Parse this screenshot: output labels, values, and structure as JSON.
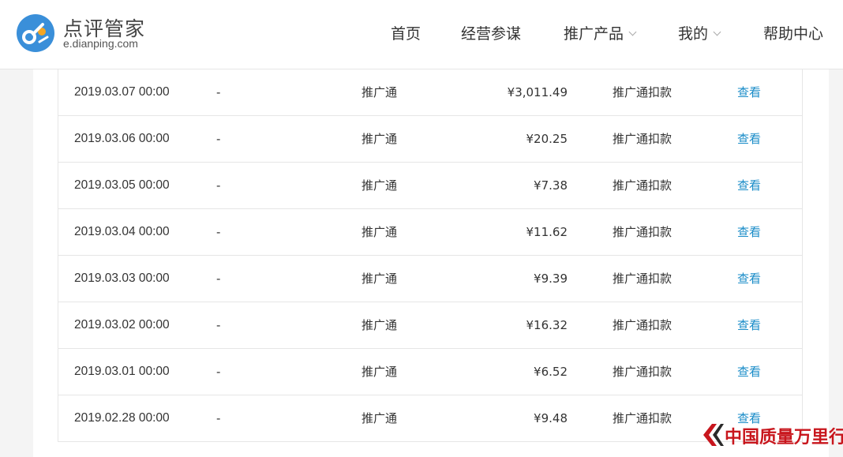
{
  "header": {
    "brand_title": "点评管家",
    "brand_url": "e.dianping.com",
    "nav": [
      {
        "label": "首页",
        "has_dropdown": false
      },
      {
        "label": "经营参谋",
        "has_dropdown": false
      },
      {
        "label": "推广产品",
        "has_dropdown": true
      },
      {
        "label": "我的",
        "has_dropdown": true
      },
      {
        "label": "帮助中心",
        "has_dropdown": false
      }
    ]
  },
  "table": {
    "rows": [
      {
        "date": "2019.03.07 00:00",
        "dash": "-",
        "type": "推广通",
        "amount": "¥3,011.49",
        "desc": "推广通扣款",
        "action": "查看"
      },
      {
        "date": "2019.03.06 00:00",
        "dash": "-",
        "type": "推广通",
        "amount": "¥20.25",
        "desc": "推广通扣款",
        "action": "查看"
      },
      {
        "date": "2019.03.05 00:00",
        "dash": "-",
        "type": "推广通",
        "amount": "¥7.38",
        "desc": "推广通扣款",
        "action": "查看"
      },
      {
        "date": "2019.03.04 00:00",
        "dash": "-",
        "type": "推广通",
        "amount": "¥11.62",
        "desc": "推广通扣款",
        "action": "查看"
      },
      {
        "date": "2019.03.03 00:00",
        "dash": "-",
        "type": "推广通",
        "amount": "¥9.39",
        "desc": "推广通扣款",
        "action": "查看"
      },
      {
        "date": "2019.03.02 00:00",
        "dash": "-",
        "type": "推广通",
        "amount": "¥16.32",
        "desc": "推广通扣款",
        "action": "查看"
      },
      {
        "date": "2019.03.01 00:00",
        "dash": "-",
        "type": "推广通",
        "amount": "¥6.52",
        "desc": "推广通扣款",
        "action": "查看"
      },
      {
        "date": "2019.02.28 00:00",
        "dash": "-",
        "type": "推广通",
        "amount": "¥9.48",
        "desc": "推广通扣款",
        "action": "查看"
      }
    ]
  },
  "watermark": {
    "text": "中国质量万里行"
  },
  "colors": {
    "brand_blue": "#3a8fd9",
    "brand_orange": "#f5a623",
    "link": "#1a8cc8",
    "watermark_red": "#c8161d"
  }
}
